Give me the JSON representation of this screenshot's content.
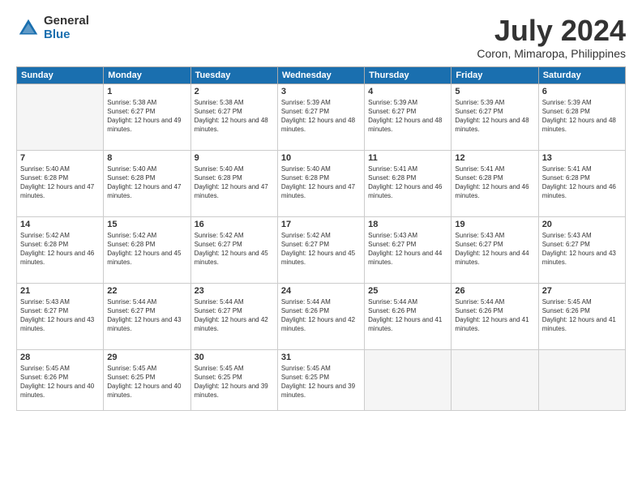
{
  "logo": {
    "general": "General",
    "blue": "Blue"
  },
  "title": "July 2024",
  "location": "Coron, Mimaropa, Philippines",
  "days_header": [
    "Sunday",
    "Monday",
    "Tuesday",
    "Wednesday",
    "Thursday",
    "Friday",
    "Saturday"
  ],
  "weeks": [
    [
      {
        "num": "",
        "sunrise": "",
        "sunset": "",
        "daylight": ""
      },
      {
        "num": "1",
        "sunrise": "Sunrise: 5:38 AM",
        "sunset": "Sunset: 6:27 PM",
        "daylight": "Daylight: 12 hours and 49 minutes."
      },
      {
        "num": "2",
        "sunrise": "Sunrise: 5:38 AM",
        "sunset": "Sunset: 6:27 PM",
        "daylight": "Daylight: 12 hours and 48 minutes."
      },
      {
        "num": "3",
        "sunrise": "Sunrise: 5:39 AM",
        "sunset": "Sunset: 6:27 PM",
        "daylight": "Daylight: 12 hours and 48 minutes."
      },
      {
        "num": "4",
        "sunrise": "Sunrise: 5:39 AM",
        "sunset": "Sunset: 6:27 PM",
        "daylight": "Daylight: 12 hours and 48 minutes."
      },
      {
        "num": "5",
        "sunrise": "Sunrise: 5:39 AM",
        "sunset": "Sunset: 6:27 PM",
        "daylight": "Daylight: 12 hours and 48 minutes."
      },
      {
        "num": "6",
        "sunrise": "Sunrise: 5:39 AM",
        "sunset": "Sunset: 6:28 PM",
        "daylight": "Daylight: 12 hours and 48 minutes."
      }
    ],
    [
      {
        "num": "7",
        "sunrise": "Sunrise: 5:40 AM",
        "sunset": "Sunset: 6:28 PM",
        "daylight": "Daylight: 12 hours and 47 minutes."
      },
      {
        "num": "8",
        "sunrise": "Sunrise: 5:40 AM",
        "sunset": "Sunset: 6:28 PM",
        "daylight": "Daylight: 12 hours and 47 minutes."
      },
      {
        "num": "9",
        "sunrise": "Sunrise: 5:40 AM",
        "sunset": "Sunset: 6:28 PM",
        "daylight": "Daylight: 12 hours and 47 minutes."
      },
      {
        "num": "10",
        "sunrise": "Sunrise: 5:40 AM",
        "sunset": "Sunset: 6:28 PM",
        "daylight": "Daylight: 12 hours and 47 minutes."
      },
      {
        "num": "11",
        "sunrise": "Sunrise: 5:41 AM",
        "sunset": "Sunset: 6:28 PM",
        "daylight": "Daylight: 12 hours and 46 minutes."
      },
      {
        "num": "12",
        "sunrise": "Sunrise: 5:41 AM",
        "sunset": "Sunset: 6:28 PM",
        "daylight": "Daylight: 12 hours and 46 minutes."
      },
      {
        "num": "13",
        "sunrise": "Sunrise: 5:41 AM",
        "sunset": "Sunset: 6:28 PM",
        "daylight": "Daylight: 12 hours and 46 minutes."
      }
    ],
    [
      {
        "num": "14",
        "sunrise": "Sunrise: 5:42 AM",
        "sunset": "Sunset: 6:28 PM",
        "daylight": "Daylight: 12 hours and 46 minutes."
      },
      {
        "num": "15",
        "sunrise": "Sunrise: 5:42 AM",
        "sunset": "Sunset: 6:28 PM",
        "daylight": "Daylight: 12 hours and 45 minutes."
      },
      {
        "num": "16",
        "sunrise": "Sunrise: 5:42 AM",
        "sunset": "Sunset: 6:27 PM",
        "daylight": "Daylight: 12 hours and 45 minutes."
      },
      {
        "num": "17",
        "sunrise": "Sunrise: 5:42 AM",
        "sunset": "Sunset: 6:27 PM",
        "daylight": "Daylight: 12 hours and 45 minutes."
      },
      {
        "num": "18",
        "sunrise": "Sunrise: 5:43 AM",
        "sunset": "Sunset: 6:27 PM",
        "daylight": "Daylight: 12 hours and 44 minutes."
      },
      {
        "num": "19",
        "sunrise": "Sunrise: 5:43 AM",
        "sunset": "Sunset: 6:27 PM",
        "daylight": "Daylight: 12 hours and 44 minutes."
      },
      {
        "num": "20",
        "sunrise": "Sunrise: 5:43 AM",
        "sunset": "Sunset: 6:27 PM",
        "daylight": "Daylight: 12 hours and 43 minutes."
      }
    ],
    [
      {
        "num": "21",
        "sunrise": "Sunrise: 5:43 AM",
        "sunset": "Sunset: 6:27 PM",
        "daylight": "Daylight: 12 hours and 43 minutes."
      },
      {
        "num": "22",
        "sunrise": "Sunrise: 5:44 AM",
        "sunset": "Sunset: 6:27 PM",
        "daylight": "Daylight: 12 hours and 43 minutes."
      },
      {
        "num": "23",
        "sunrise": "Sunrise: 5:44 AM",
        "sunset": "Sunset: 6:27 PM",
        "daylight": "Daylight: 12 hours and 42 minutes."
      },
      {
        "num": "24",
        "sunrise": "Sunrise: 5:44 AM",
        "sunset": "Sunset: 6:26 PM",
        "daylight": "Daylight: 12 hours and 42 minutes."
      },
      {
        "num": "25",
        "sunrise": "Sunrise: 5:44 AM",
        "sunset": "Sunset: 6:26 PM",
        "daylight": "Daylight: 12 hours and 41 minutes."
      },
      {
        "num": "26",
        "sunrise": "Sunrise: 5:44 AM",
        "sunset": "Sunset: 6:26 PM",
        "daylight": "Daylight: 12 hours and 41 minutes."
      },
      {
        "num": "27",
        "sunrise": "Sunrise: 5:45 AM",
        "sunset": "Sunset: 6:26 PM",
        "daylight": "Daylight: 12 hours and 41 minutes."
      }
    ],
    [
      {
        "num": "28",
        "sunrise": "Sunrise: 5:45 AM",
        "sunset": "Sunset: 6:26 PM",
        "daylight": "Daylight: 12 hours and 40 minutes."
      },
      {
        "num": "29",
        "sunrise": "Sunrise: 5:45 AM",
        "sunset": "Sunset: 6:25 PM",
        "daylight": "Daylight: 12 hours and 40 minutes."
      },
      {
        "num": "30",
        "sunrise": "Sunrise: 5:45 AM",
        "sunset": "Sunset: 6:25 PM",
        "daylight": "Daylight: 12 hours and 39 minutes."
      },
      {
        "num": "31",
        "sunrise": "Sunrise: 5:45 AM",
        "sunset": "Sunset: 6:25 PM",
        "daylight": "Daylight: 12 hours and 39 minutes."
      },
      {
        "num": "",
        "sunrise": "",
        "sunset": "",
        "daylight": ""
      },
      {
        "num": "",
        "sunrise": "",
        "sunset": "",
        "daylight": ""
      },
      {
        "num": "",
        "sunrise": "",
        "sunset": "",
        "daylight": ""
      }
    ]
  ]
}
